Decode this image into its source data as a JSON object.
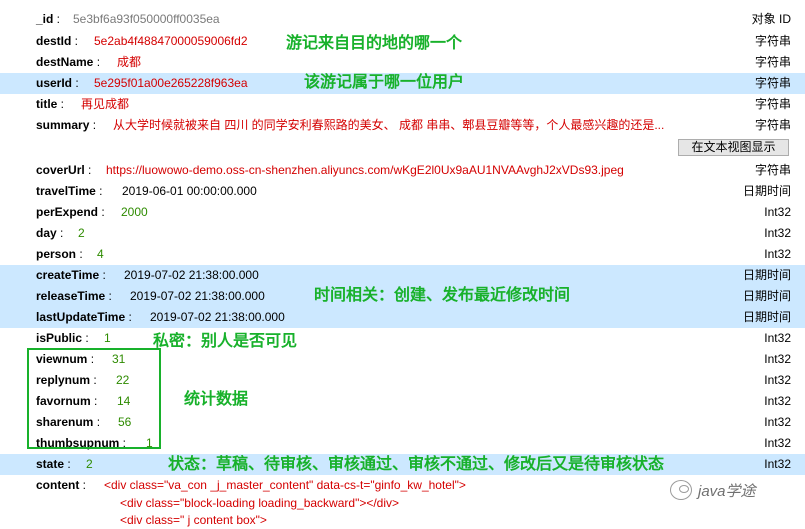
{
  "rows": [
    {
      "key": "_id",
      "value": "5e3bf6a93f050000ff0035ea",
      "type": "对象 ID",
      "value_style": "gray",
      "highlight": false
    },
    {
      "key": "destId",
      "value": "5e2ab4f48847000059006fd2",
      "type": "字符串",
      "value_style": "red",
      "highlight": false
    },
    {
      "key": "destName",
      "value": "成都",
      "type": "字符串",
      "value_style": "red",
      "highlight": false
    },
    {
      "key": "userId",
      "value": "5e295f01a00e265228f963ea",
      "type": "字符串",
      "value_style": "red",
      "highlight": true
    },
    {
      "key": "title",
      "value": "再见成都",
      "type": "字符串",
      "value_style": "red",
      "highlight": false
    },
    {
      "key": "summary",
      "value": "从大学时候就被来自 四川 的同学安利春熙路的美女、 成都 串串、郫县豆瓣等等，个人最感兴趣的还是...",
      "type": "字符串",
      "value_style": "red",
      "highlight": false
    },
    {
      "key": "coverUrl",
      "value": "https://luowowo-demo.oss-cn-shenzhen.aliyuncs.com/wKgE2l0Ux9aAU1NVAAvghJ2xVDs93.jpeg",
      "type": "字符串",
      "value_style": "red",
      "highlight": false
    },
    {
      "key": "travelTime",
      "value": "2019-06-01 00:00:00.000",
      "type": "日期时间",
      "value_style": "plain",
      "highlight": false
    },
    {
      "key": "perExpend",
      "value": "2000",
      "type": "Int32",
      "value_style": "green",
      "highlight": false
    },
    {
      "key": "day",
      "value": "2",
      "type": "Int32",
      "value_style": "green",
      "highlight": false
    },
    {
      "key": "person",
      "value": "4",
      "type": "Int32",
      "value_style": "green",
      "highlight": false
    },
    {
      "key": "createTime",
      "value": "2019-07-02 21:38:00.000",
      "type": "日期时间",
      "value_style": "plain",
      "highlight": true
    },
    {
      "key": "releaseTime",
      "value": "2019-07-02 21:38:00.000",
      "type": "日期时间",
      "value_style": "plain",
      "highlight": true
    },
    {
      "key": "lastUpdateTime",
      "value": "2019-07-02 21:38:00.000",
      "type": "日期时间",
      "value_style": "plain",
      "highlight": true
    },
    {
      "key": "isPublic",
      "value": "1",
      "type": "Int32",
      "value_style": "green",
      "highlight": false
    },
    {
      "key": "viewnum",
      "value": "31",
      "type": "Int32",
      "value_style": "green",
      "highlight": false
    },
    {
      "key": "replynum",
      "value": "22",
      "type": "Int32",
      "value_style": "green",
      "highlight": false
    },
    {
      "key": "favornum",
      "value": "14",
      "type": "Int32",
      "value_style": "green",
      "highlight": false
    },
    {
      "key": "sharenum",
      "value": "56",
      "type": "Int32",
      "value_style": "green",
      "highlight": false
    },
    {
      "key": "thumbsupnum",
      "value": "1",
      "type": "Int32",
      "value_style": "green",
      "highlight": false
    },
    {
      "key": "state",
      "value": "2",
      "type": "Int32",
      "value_style": "green",
      "highlight": true
    },
    {
      "key": "content",
      "value": "<div class=\"va_con _j_master_content\" data-cs-t=\"ginfo_kw_hotel\">",
      "type": "",
      "value_style": "red",
      "highlight": false
    }
  ],
  "content_lines": [
    "<div class=\"block-loading loading_backward\"></div>",
    "<div class=\" j content box\">"
  ],
  "view_text_button": "在文本视图显示",
  "annotations": {
    "dest": "游记来自目的地的哪一个",
    "user": "该游记属于哪一位用户",
    "time": "时间相关：创建、发布最近修改时间",
    "public": "私密：别人是否可见",
    "stats": "统计数据",
    "state": "状态：草稿、待审核、审核通过、审核不通过、修改后又是待审核状态"
  },
  "watermark": "java学途",
  "colors": {
    "annotation": "#18b12b",
    "highlight": "#cce8ff",
    "string_value": "#d40000",
    "number_value": "#2e8b00"
  }
}
